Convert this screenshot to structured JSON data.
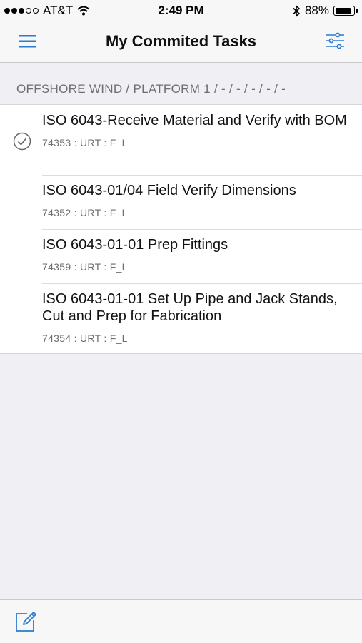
{
  "status_bar": {
    "carrier": "AT&T",
    "time": "2:49 PM",
    "battery_percent": "88%",
    "signal_bars_filled": 3,
    "signal_bars_total": 5
  },
  "nav": {
    "title": "My Commited Tasks",
    "left_icon": "hamburger-menu-icon",
    "right_icon": "filter-sliders-icon"
  },
  "section": {
    "header": "OFFSHORE WIND / PLATFORM 1 / - / - / - / - / -"
  },
  "tasks": [
    {
      "title": "ISO 6043-Receive Material and Verify with BOM",
      "subtitle": "74353 : URT : F_L",
      "checked": true
    },
    {
      "title": "ISO 6043-01/04 Field Verify Dimensions",
      "subtitle": "74352 : URT : F_L",
      "checked": false
    },
    {
      "title": "ISO 6043-01-01 Prep Fittings",
      "subtitle": "74359 : URT : F_L",
      "checked": false
    },
    {
      "title": "ISO 6043-01-01 Set Up Pipe and Jack Stands, Cut and Prep for Fabrication",
      "subtitle": "74354 : URT : F_L",
      "checked": false
    }
  ],
  "toolbar": {
    "compose_icon": "compose-icon"
  },
  "colors": {
    "accent": "#2a7bd2",
    "background": "#efeff4",
    "bar": "#f7f7f7",
    "secondary_text": "#6d6d72"
  }
}
